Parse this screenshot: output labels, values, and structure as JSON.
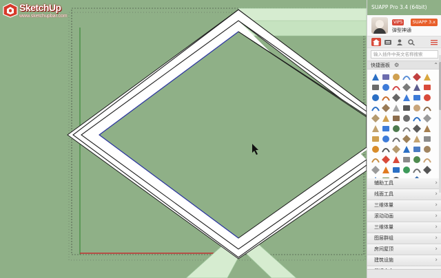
{
  "logo": {
    "name": "SketchUp",
    "url": "www.sketchupbar.com"
  },
  "panel": {
    "title": "SUAPP Pro 3.4 (64bit)",
    "vip_badge": "VIP5",
    "username": "弹型神通",
    "brand_badge": "SUAPP 3.x",
    "search_placeholder": "输入插件中英文名称搜索",
    "quick_panel_label": "快捷面板",
    "categories": [
      "辅助工具",
      "线面工具",
      "三维体量",
      "滚动动画",
      "三维体量",
      "图层群组",
      "房间屋顶",
      "建筑设施",
      "最近命令"
    ],
    "tool_icons": [
      "butterfly",
      "hat",
      "blade",
      "shape",
      "hand",
      "pen",
      "lines",
      "curve",
      "arc",
      "bridge",
      "loop",
      "cut",
      "house",
      "hook",
      "knife",
      "ramp",
      "stripes",
      "slash",
      "blue-diamond",
      "bowl",
      "sphere",
      "rings",
      "cube-red",
      "grid-box",
      "roof",
      "mitre",
      "stick",
      "wave",
      "parts",
      "cone",
      "frame",
      "rod",
      "pins",
      "chain",
      "brackets",
      "box",
      "pyramid",
      "brush",
      "hinge",
      "window",
      "fan",
      "block",
      "ball",
      "sphere-dark",
      "slab",
      "cube-blue",
      "tower",
      "bowl-edge",
      "house-dot",
      "cross",
      "brush-red",
      "shard",
      "pipe",
      "bag",
      "gear",
      "orange",
      "panel",
      "grid",
      "split",
      "pyramid-dark",
      "bucket",
      "plane",
      "arc-small",
      "saw",
      "drop",
      ""
    ],
    "tool_colors": [
      "#2b6fc4",
      "#6c6cae",
      "#d0a050",
      "#5a8ed6",
      "#c04040",
      "#d9a740",
      "#6a6a6a",
      "#3d7bd8",
      "#d24545",
      "#7a7a7a",
      "#5b5b8c",
      "#d84a3a",
      "#2b6fc4",
      "#c86a2a",
      "#666666",
      "#3d7bd8",
      "#3d7bd8",
      "#d84a3a",
      "#2b6fc4",
      "#9a7a55",
      "#a5a5a5",
      "#555555",
      "#c9a57a",
      "#8a6b4a",
      "#b59a6e",
      "#d0a050",
      "#8d6d4c",
      "#6c6c6c",
      "#2b6fc4",
      "#9a9a9a",
      "#c1a16d",
      "#3d7bd8",
      "#4d7a4d",
      "#7a7a7a",
      "#5a5a5a",
      "#a57f50",
      "#d0a050",
      "#3d7bd8",
      "#6a6a6a",
      "#9d8057",
      "#c4a36f",
      "#8c8c8c",
      "#d98c2a",
      "#555555",
      "#b59a6e",
      "#2b6fc4",
      "#4a7bc2",
      "#a08460",
      "#c88d3f",
      "#d84a3a",
      "#d84a3a",
      "#8a8a8a",
      "#4e8a4e",
      "#c8a070",
      "#9a9a9a",
      "#e07a20",
      "#2b6fc4",
      "#3d9a5a",
      "#6f6f6f",
      "#555555",
      "#2b6fc4",
      "#6b8a4e",
      "#5c5c5c",
      "#8a8a8a",
      "#3a6fb0",
      "#ffffff"
    ]
  },
  "colors": {
    "viewport_bg": "#8fb087",
    "accent": "#d84a3a",
    "frame": "#ffffff",
    "edge_blue": "#2f3aa8"
  }
}
